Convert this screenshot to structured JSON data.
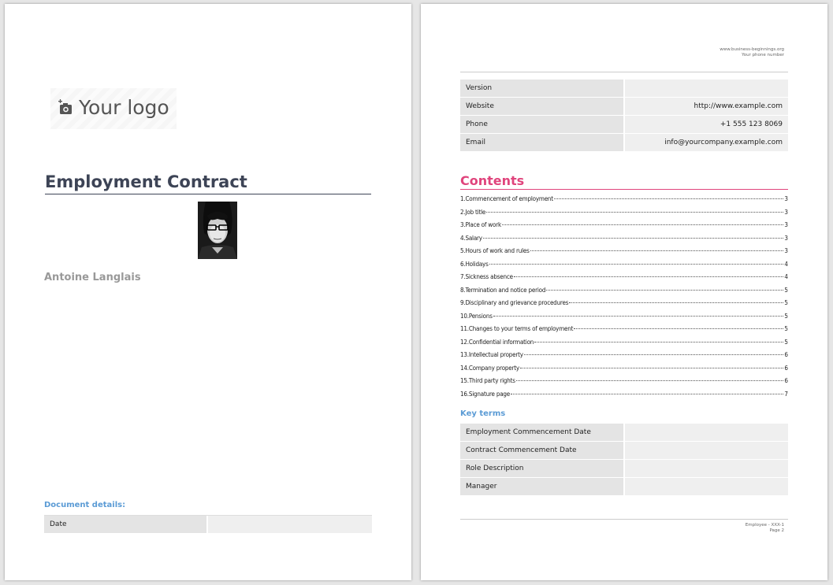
{
  "page1": {
    "logo_text": "Your logo",
    "title": "Employment Contract",
    "author": "Antoine Langlais",
    "document_details_heading": "Document details:",
    "details": [
      {
        "label": "Date",
        "value": ""
      }
    ]
  },
  "page2": {
    "header": {
      "website": "www.business-beginnings.org",
      "phone": "Your phone number"
    },
    "info": [
      {
        "label": "Version",
        "value": ""
      },
      {
        "label": "Website",
        "value": "http://www.example.com"
      },
      {
        "label": "Phone",
        "value": "+1 555 123 8069"
      },
      {
        "label": "Email",
        "value": "info@yourcompany.example.com"
      }
    ],
    "contents_title": "Contents",
    "toc": [
      {
        "label": "1.Commencement of employment",
        "page": "3"
      },
      {
        "label": "2.Job title",
        "page": "3"
      },
      {
        "label": "3.Place of work",
        "page": "3"
      },
      {
        "label": "4.Salary",
        "page": "3"
      },
      {
        "label": "5.Hours of work and rules",
        "page": "3"
      },
      {
        "label": "6.Holidays",
        "page": "4"
      },
      {
        "label": "7.Sickness absence",
        "page": "4"
      },
      {
        "label": "8.Termination and notice period",
        "page": "5"
      },
      {
        "label": "9.Disciplinary and grievance procedures",
        "page": "5"
      },
      {
        "label": "10.Pensions",
        "page": "5"
      },
      {
        "label": "11.Changes to your terms of employment",
        "page": "5"
      },
      {
        "label": "12.Confidential information",
        "page": "5"
      },
      {
        "label": "13.Intellectual property",
        "page": "6"
      },
      {
        "label": "14.Company property",
        "page": "6"
      },
      {
        "label": "15.Third party rights",
        "page": "6"
      },
      {
        "label": "16.Signature page",
        "page": "7"
      }
    ],
    "key_terms_heading": "Key terms",
    "key_terms": [
      {
        "label": "Employment Commencement Date",
        "value": ""
      },
      {
        "label": "Contract Commencement Date",
        "value": ""
      },
      {
        "label": "Role Description",
        "value": ""
      },
      {
        "label": "Manager",
        "value": ""
      }
    ],
    "footer": {
      "doc_ref": "Employee - XXX-1",
      "page": "Page 2"
    }
  },
  "colors": {
    "title": "#3d4456",
    "contents_accent": "#e0447c",
    "section_heading": "#5b9bd5",
    "table_label_bg": "#e4e4e4",
    "table_value_bg": "#efefef"
  },
  "icons": {
    "logo": "camera-plus-icon"
  }
}
